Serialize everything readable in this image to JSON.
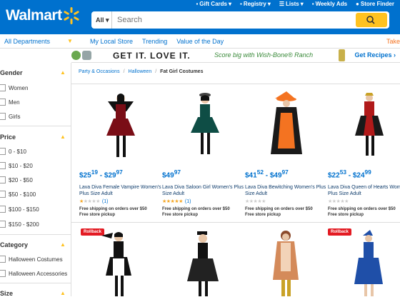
{
  "header": {
    "logo_text": "Walmart",
    "search": {
      "category": "All",
      "placeholder": "Search"
    },
    "top_links": [
      {
        "label": "Gift Cards",
        "icon": "gift-icon",
        "chevron": true
      },
      {
        "label": "Registry",
        "icon": "gift-box-icon",
        "chevron": true
      },
      {
        "label": "Lists",
        "icon": "list-icon",
        "chevron": true
      },
      {
        "label": "Weekly Ads",
        "icon": "ad-icon",
        "chevron": false
      },
      {
        "label": "Store Finder",
        "icon": "location-pin-icon",
        "chevron": false
      }
    ]
  },
  "nav": {
    "departments": "All Departments",
    "links": [
      "My Local Store",
      "Trending",
      "Value of the Day"
    ],
    "right_text": "Take"
  },
  "banner": {
    "headline": "GET IT. LOVE IT.",
    "subtext": "Score big with Wish-Bone® Ranch",
    "cta": "Get Recipes ›"
  },
  "sidebar": {
    "gender": {
      "title": "Gender",
      "items": [
        "Women",
        "Men",
        "Girls"
      ]
    },
    "price": {
      "title": "Price",
      "items": [
        "0 - $10",
        "$10 - $20",
        "$20 - $50",
        "$50 - $100",
        "$100 - $150",
        "$150 - $200"
      ]
    },
    "category": {
      "title": "Category",
      "items": [
        "Halloween Costumes",
        "Halloween Accessories"
      ]
    },
    "size": {
      "title": "Size"
    }
  },
  "breadcrumb": [
    "Party & Occasions",
    "Halloween",
    "Fat Girl Costumes"
  ],
  "products": [
    {
      "price_from_d": "$25",
      "price_from_c": "19",
      "price_to_d": "$29",
      "price_to_c": "97",
      "title": "Lava Diva Female Vampire Women's Plus Size Adult",
      "rating": 1,
      "reviews": "(1)",
      "ship": "Free shipping on orders over $50",
      "pickup": "Free store pickup",
      "rollback": ""
    },
    {
      "price_from_d": "$49",
      "price_from_c": "97",
      "price_to_d": "",
      "price_to_c": "",
      "title": "Lava Diva Saloon Girl Women's Plus Size Adult",
      "rating": 5,
      "reviews": "(1)",
      "ship": "Free shipping on orders over $50",
      "pickup": "Free store pickup",
      "rollback": ""
    },
    {
      "price_from_d": "$41",
      "price_from_c": "52",
      "price_to_d": "$49",
      "price_to_c": "97",
      "title": "Lava Diva Bewitching Women's Plus Size Adult",
      "rating": 0,
      "reviews": "",
      "ship": "Free shipping on orders over $50",
      "pickup": "Free store pickup",
      "rollback": ""
    },
    {
      "price_from_d": "$22",
      "price_from_c": "53",
      "price_to_d": "$24",
      "price_to_c": "99",
      "title": "Lava Diva Queen of Hearts Women's Plus Size Adult",
      "rating": 0,
      "reviews": "",
      "ship": "Free shipping on orders over $50",
      "pickup": "Free store pickup",
      "rollback": ""
    }
  ],
  "row2": [
    {
      "rollback": "Rollback"
    },
    {
      "rollback": ""
    },
    {
      "rollback": ""
    },
    {
      "rollback": "Rollback"
    }
  ],
  "colors": {
    "brand_blue": "#0071ce",
    "spark_yellow": "#ffc220",
    "rollback_red": "#e31b23"
  }
}
